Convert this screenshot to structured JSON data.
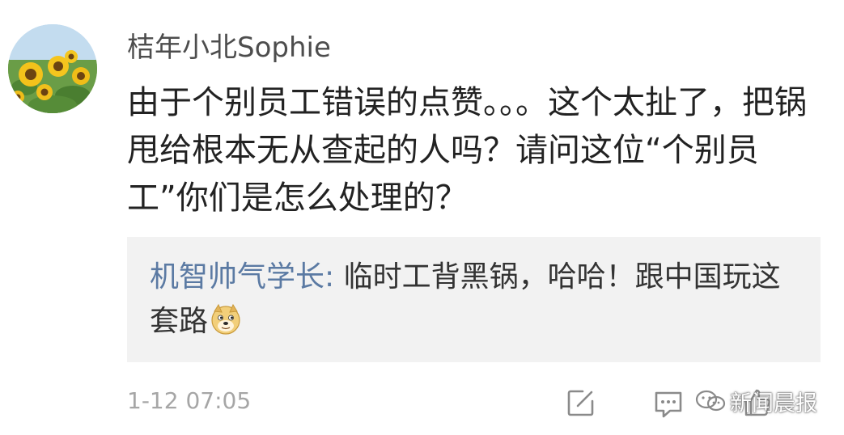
{
  "comment": {
    "username": "桔年小北Sophie",
    "text": "由于个别员工错误的点赞。。。这个太扯了，把锅甩给根本无从查起的人吗？请问这位“个别员工”你们是怎么处理的？",
    "timestamp": "1-12 07:05"
  },
  "reply": {
    "username": "机智帅气学长:",
    "text": " 临时工背黑锅，哈哈！跟中国玩这套路",
    "emoji": "doge-emoji"
  },
  "actions": {
    "edit_icon": "edit-icon",
    "comment_icon": "comment-icon",
    "like_icon": "thumbs-up-icon"
  },
  "watermark": {
    "text": "新闻晨报"
  },
  "colors": {
    "username": "#4d4d4d",
    "reply_username": "#5b7aa3",
    "reply_background": "#f2f2f2",
    "timestamp": "#a6a6a6"
  }
}
